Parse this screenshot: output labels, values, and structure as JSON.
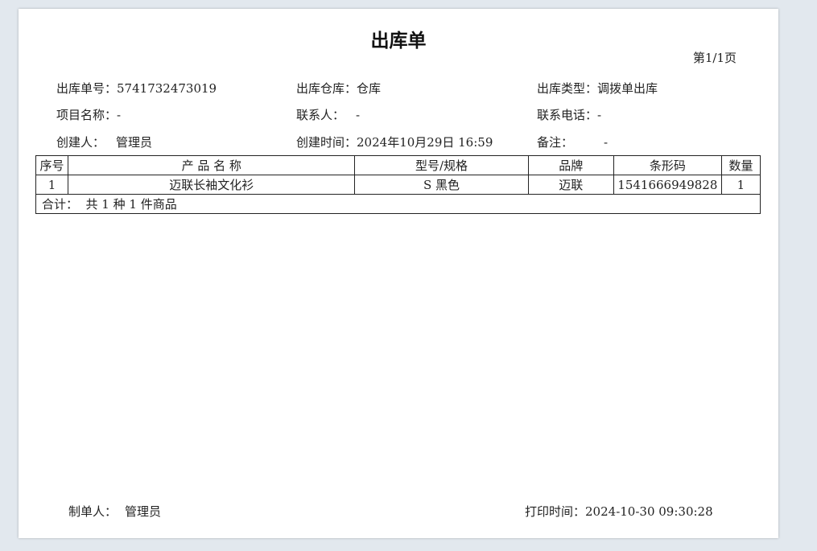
{
  "document": {
    "title": "出库单",
    "page_number": "第1/1页"
  },
  "info": {
    "order_no_label": "出库单号：",
    "order_no_value": "5741732473019",
    "warehouse_label": "出库仓库：",
    "warehouse_value": "仓库",
    "type_label": "出库类型：",
    "type_value": "调拨单出库",
    "project_label": "项目名称：",
    "project_value": "-",
    "contact_label": "联系人：",
    "contact_value": "-",
    "phone_label": "联系电话：",
    "phone_value": "-",
    "creator_label": "创建人：",
    "creator_value": "管理员",
    "created_time_label": "创建时间：",
    "created_time_value": "2024年10月29日 16:59",
    "remark_label": "备注：",
    "remark_value": "-"
  },
  "table": {
    "headers": [
      "序号",
      "产 品 名 称",
      "型号/规格",
      "品牌",
      "条形码",
      "数量"
    ],
    "rows": [
      [
        "1",
        "迈联长袖文化衫",
        "S 黑色",
        "迈联",
        "1541666949828",
        "1"
      ]
    ],
    "summary": "合计：  共 1 种 1 件商品"
  },
  "footer": {
    "maker_label": "制单人：",
    "maker_value": "管理员",
    "print_time_label": "打印时间：",
    "print_time_value": "2024-10-30 09:30:28"
  }
}
